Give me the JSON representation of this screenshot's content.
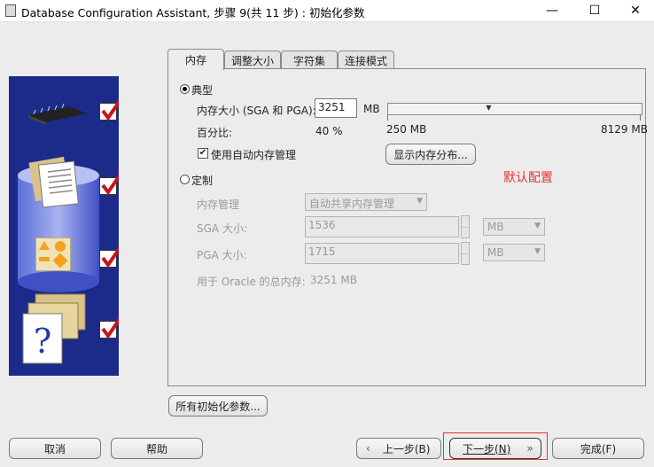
{
  "window": {
    "title": "Database Configuration Assistant, 步骤 9(共 11 步) : 初始化参数",
    "min_glyph": "—",
    "max_glyph": "☐",
    "close_glyph": "✕"
  },
  "tabs": [
    "内存",
    "调整大小",
    "字符集",
    "连接模式"
  ],
  "typical": {
    "label": "典型",
    "memory_size_label": "内存大小 (SGA 和 PGA):",
    "memory_size_value": "3251",
    "memory_unit": "MB",
    "slider_min": "250 MB",
    "slider_max": "8129 MB",
    "slider_percent": 40,
    "percent_label": "百分比:",
    "percent_value": "40 %",
    "auto_memory_label": "使用自动内存管理",
    "show_memory_button": "显示内存分布..."
  },
  "annotation": {
    "text": "默认配置",
    "color": "#e8312f"
  },
  "custom": {
    "label": "定制",
    "memory_mgmt_label": "内存管理",
    "memory_mgmt_value": "自动共享内存管理",
    "sga_label": "SGA 大小:",
    "sga_value": "1536",
    "sga_unit": "MB",
    "pga_label": "PGA 大小:",
    "pga_value": "1715",
    "pga_unit": "MB",
    "oracle_total": "用于 Oracle 的总内存:",
    "oracle_total_value": "3251 MB"
  },
  "all_params_button": "所有初始化参数...",
  "footer": {
    "cancel": "取消",
    "help": "帮助",
    "back": "上一步(B)",
    "next": "下一步(N)",
    "finish": "完成(F)",
    "highlight_color": "#e8312f"
  }
}
